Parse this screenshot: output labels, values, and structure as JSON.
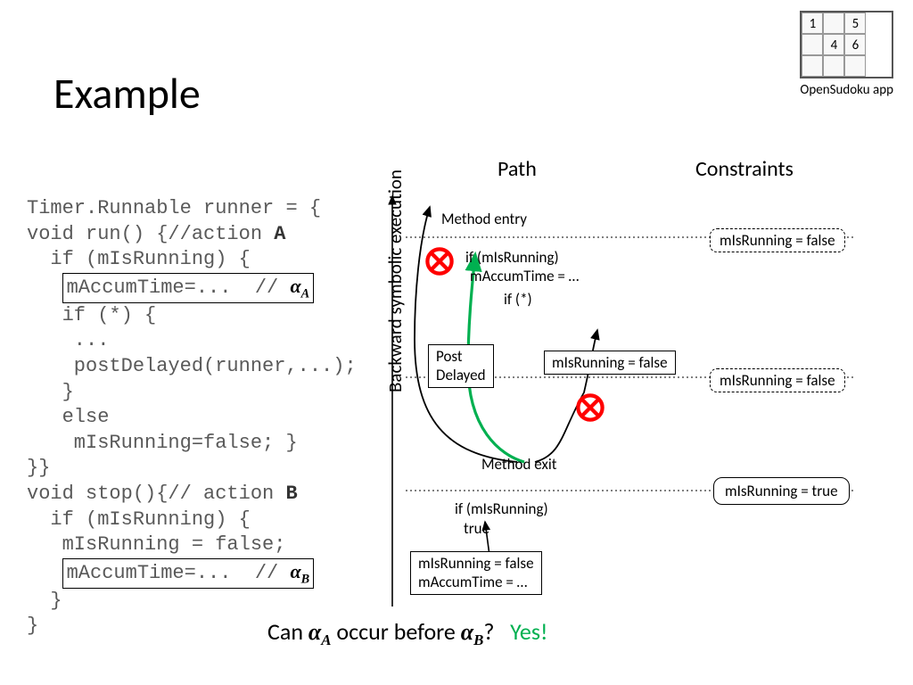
{
  "title": "Example",
  "sudoku": {
    "caption": "OpenSudoku app",
    "cells": [
      "1",
      "",
      "5",
      "",
      "4",
      "6",
      "",
      "",
      ""
    ]
  },
  "columns": {
    "path": "Path",
    "constraints": "Constraints"
  },
  "axis_label": "Backward symbolic execution",
  "code": {
    "l1": "Timer.Runnable runner = {",
    "l2a": "void run() {//action ",
    "l2b": "A",
    "l3": "  if (mIsRunning) {",
    "l4box_code": "mAccumTime=...  // ",
    "l4box_alpha": "α",
    "l4box_sub": "A",
    "l5": "   if (*) {",
    "l6": "    ...",
    "l7": "    postDelayed(runner,...);",
    "l8": "   }",
    "l9": "   else",
    "l10": "    mIsRunning=false; }",
    "l11": "}}",
    "l12a": "void stop(){// action ",
    "l12b": "B",
    "l13": "  if (mIsRunning) {",
    "l14": "   mIsRunning = false;",
    "l15box_code": "mAccumTime=...  // ",
    "l15box_alpha": "α",
    "l15box_sub": "B",
    "l16": "  }",
    "l17": "}"
  },
  "diagram": {
    "method_entry": "Method entry",
    "if_running": "if (mIsRunning)",
    "maccum": "mAccumTime = …",
    "if_star": "if (*)",
    "post_delayed_l1": "Post",
    "post_delayed_l2": "Delayed",
    "running_false_path": "mIsRunning = false",
    "method_exit": "Method exit",
    "if_running2": "if (mIsRunning)",
    "true_label": "true",
    "bottom_l1": "mIsRunning = false",
    "bottom_l2": "mAccumTime = …",
    "constraint_top": "mIsRunning = false",
    "constraint_mid": "mIsRunning = false",
    "constraint_bot": "mIsRunning = true"
  },
  "question": {
    "prefix": "Can ",
    "alpha": "α",
    "sub_a": "A",
    "mid": " occur before ",
    "sub_b": "B",
    "suffix": "?",
    "answer": "Yes!"
  }
}
